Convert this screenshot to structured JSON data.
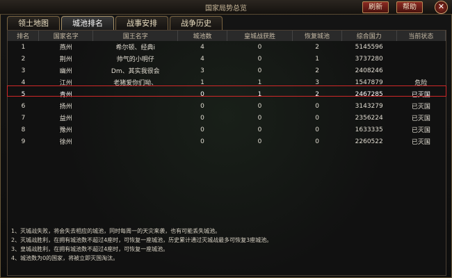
{
  "window": {
    "title": "国家局势总览",
    "refresh_label": "刷新",
    "help_label": "帮助",
    "close_label": "✕"
  },
  "tabs": [
    {
      "label": "领土地图"
    },
    {
      "label": "城池排名"
    },
    {
      "label": "战事安排"
    },
    {
      "label": "战争历史"
    }
  ],
  "table": {
    "headers": [
      "排名",
      "国家名字",
      "国王名字",
      "城池数",
      "皇城战获胜",
      "恢复城池",
      "综合国力",
      "当前状态"
    ],
    "rows": [
      [
        "1",
        "燕州",
        "希尔顿、经典i",
        "4",
        "0",
        "2",
        "5145596",
        ""
      ],
      [
        "2",
        "荆州",
        "帅气的小明仔",
        "4",
        "0",
        "1",
        "3737280",
        ""
      ],
      [
        "3",
        "幽州",
        "Dm、其实我很会",
        "3",
        "0",
        "2",
        "2408246",
        ""
      ],
      [
        "4",
        "江州",
        "老猪爱你们呦、",
        "1",
        "1",
        "3",
        "1547879",
        "危险"
      ],
      [
        "5",
        "青州",
        "",
        "0",
        "1",
        "2",
        "2467285",
        "已灭国"
      ],
      [
        "6",
        "扬州",
        "",
        "0",
        "0",
        "0",
        "3143279",
        "已灭国"
      ],
      [
        "7",
        "益州",
        "",
        "0",
        "0",
        "0",
        "2356224",
        "已灭国"
      ],
      [
        "8",
        "豫州",
        "",
        "0",
        "0",
        "0",
        "1633335",
        "已灭国"
      ],
      [
        "9",
        "徐州",
        "",
        "0",
        "0",
        "0",
        "2260522",
        "已灭国"
      ]
    ]
  },
  "tips": [
    "1、灭城战失败，将会失去相应的城池，同时每周一的天灾来袭，也有可能丢失城池。",
    "2、灭城战胜利，在拥有城池数不超过4座时，可恢复一座城池，历史累计通过灭城战最多可恢复3座城池。",
    "3、皇城战胜利，在拥有城池数不超过4座时，可恢复一座城池。",
    "4、城池数为0的国家，将被立即灭国淘汰。"
  ]
}
